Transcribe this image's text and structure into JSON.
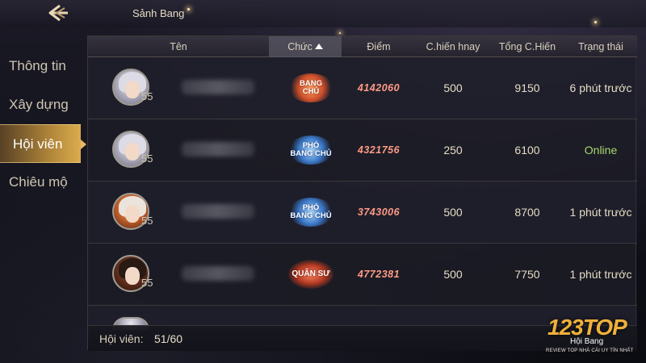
{
  "header": {
    "title": "Sảnh Bang"
  },
  "sidebar": {
    "items": [
      {
        "label": "Thông tin"
      },
      {
        "label": "Xây dựng"
      },
      {
        "label": "Hội viên",
        "active": true
      },
      {
        "label": "Chiêu mộ"
      }
    ]
  },
  "table": {
    "columns": [
      "Tên",
      "Chức",
      "Điểm",
      "C.hiến hnay",
      "Tổng C.Hiến",
      "Trạng thái"
    ],
    "sorted_column": "Chức",
    "rows": [
      {
        "level": "55",
        "role_line1": "BANG",
        "role_line2": "CHỦ",
        "role_style": "gold",
        "score": "4142060",
        "today": "500",
        "total": "9150",
        "status": "6 phút trước",
        "avatar": "silver-hair"
      },
      {
        "level": "55",
        "role_line1": "PHÓ",
        "role_line2": "BANG CHỦ",
        "role_style": "blue",
        "score": "4321756",
        "today": "250",
        "total": "6100",
        "status": "Online",
        "avatar": "silver-hair"
      },
      {
        "level": "55",
        "role_line1": "PHÓ",
        "role_line2": "BANG CHỦ",
        "role_style": "blue",
        "score": "3743006",
        "today": "500",
        "total": "8700",
        "status": "1 phút trước",
        "avatar": "red-armor"
      },
      {
        "level": "55",
        "role_line1": "QUÂN SƯ",
        "role_line2": "",
        "role_style": "red",
        "score": "4772381",
        "today": "500",
        "total": "7750",
        "status": "1 phút trước",
        "avatar": "dark-hair"
      }
    ]
  },
  "footer": {
    "members_label": "Hội viên:",
    "members_count": "51/60"
  },
  "watermark": {
    "big": "123TOP",
    "mid": "Hội Bang",
    "small": "REVIEW TOP NHÀ CÁI UY TÍN NHẤT"
  },
  "colors": {
    "score": "#ff9a86",
    "online": "#a9d86e",
    "active_tab": "#e8b86a"
  }
}
